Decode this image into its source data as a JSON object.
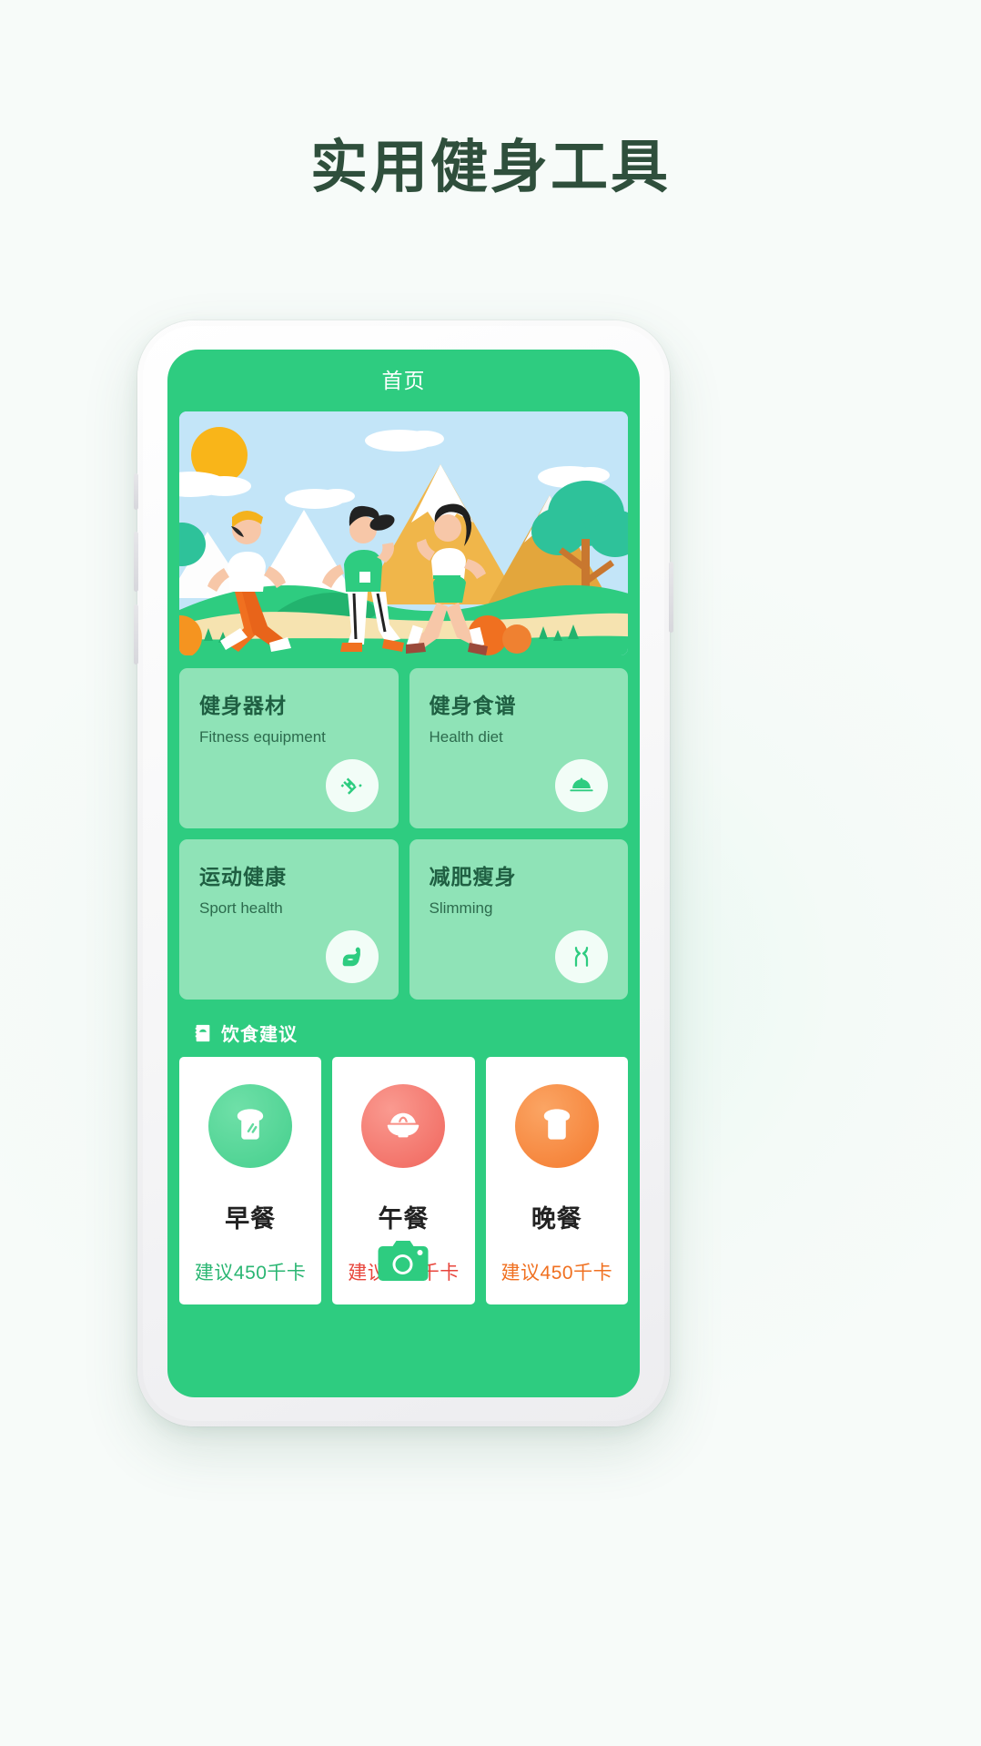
{
  "page": {
    "title": "实用健身工具",
    "title_color": "#2f4f3c",
    "background_accent": "#eef9f4"
  },
  "app": {
    "header": {
      "title": "首页",
      "bg_color": "#2ecc80",
      "text_color": "#ffffff"
    },
    "hero": {
      "name": "fitness-runners-illustration",
      "alt": "三人在山间小路上跑步的插画",
      "sky_color": "#c3e5f8",
      "sun_color": "#f9b519",
      "mountain_color": "#f0b64a",
      "grass_color": "#2ecc80",
      "path_color": "#f6e3b0"
    },
    "features": [
      {
        "cn": "健身器材",
        "en": "Fitness equipment",
        "icon": "dumbbell-icon"
      },
      {
        "cn": "健身食谱",
        "en": "Health diet",
        "icon": "food-cloche-icon"
      },
      {
        "cn": "运动健康",
        "en": "Sport health",
        "icon": "biceps-icon"
      },
      {
        "cn": "减肥瘦身",
        "en": "Slimming",
        "icon": "waist-slim-icon"
      }
    ],
    "feature_card_color": "#8fe3b7",
    "feature_text_color": "#1f5f42",
    "diet_section": {
      "icon": "recipe-book-icon",
      "title": "饮食建议"
    },
    "meals": [
      {
        "name": "早餐",
        "kcal": "建议450千卡",
        "icon": "bread-slice-icon",
        "circle_color": "#56d99a",
        "kcal_color": "#2bb673"
      },
      {
        "name": "午餐",
        "kcal": "建议450千卡",
        "icon": "noodle-bowl-icon",
        "circle_color": "#f4766e",
        "kcal_color": "#e8453c"
      },
      {
        "name": "晚餐",
        "kcal": "建议450千卡",
        "icon": "toast-icon",
        "circle_color": "#f58a45",
        "kcal_color": "#f07020"
      }
    ],
    "camera_overlay": {
      "icon": "camera-icon",
      "color": "#2ecc80"
    }
  }
}
